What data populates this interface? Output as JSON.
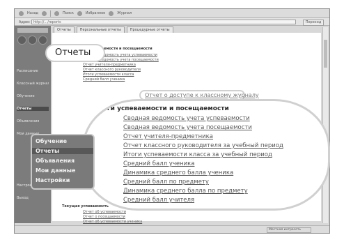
{
  "toolbar": {
    "items": [
      "Назад",
      "Вперёд",
      "Поиск",
      "Избранное",
      "Журнал"
    ]
  },
  "address": {
    "label": "Адрес",
    "value": "http://.../reports",
    "go_label": "Переход"
  },
  "sidebar": {
    "items": [
      "Расписание",
      "Классный журнал",
      "Обучение",
      "Отчеты",
      "Объявления",
      "Мои данные",
      "Настройки",
      "Выход"
    ]
  },
  "tabs": [
    "Отчеты",
    "Персональные отчеты",
    "Процедурные отчеты"
  ],
  "page_title": "Отчеты",
  "small_section_title": "Итоги успеваемости и посещаемости",
  "small_links": [
    "Сводная ведомость учета успеваемости",
    "Сводная ведомость учета посещаемости",
    "Отчет учителя-предметника",
    "Отчет классного руководителя",
    "Итоги успеваемости класса",
    "Средний балл ученика"
  ],
  "zoom": {
    "top_link": "Отчет о доступе к классному журналу",
    "heading": "Итоги успеваемости и посещаемости",
    "links": [
      "Сводная ведомость учета успеваемости",
      "Сводная ведомость учета посещаемости",
      "Отчет учителя-предметника",
      "Отчет классного руководителя за учебный период",
      "Итоги успеваемости класса за учебный период",
      "Средний балл ученика",
      "Динамика среднего балла ученика",
      "Средний балл по предмету",
      "Динамика среднего балла по предмету",
      "Средний балл учителя"
    ]
  },
  "side_callout": {
    "items": [
      "Обучение",
      "Отчеты",
      "Объявления",
      "Мои данные",
      "Настройки"
    ]
  },
  "bottom": {
    "heading": "Текущая успеваемость",
    "links": [
      "Отчет об успеваемости",
      "Отчет о посещаемости",
      "Отчет об успеваемости ученика"
    ]
  },
  "status": {
    "zone": "Местная интрасеть"
  }
}
